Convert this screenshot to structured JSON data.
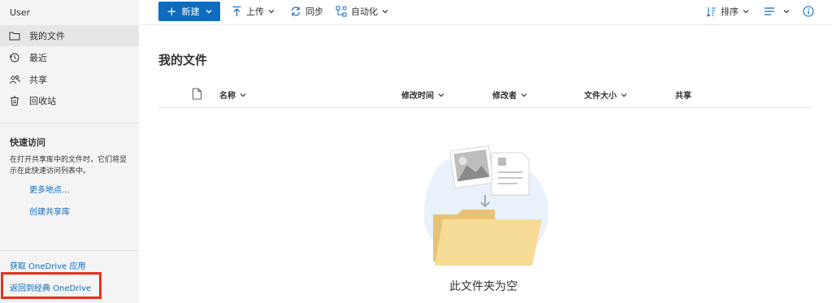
{
  "sidebar": {
    "user": "User",
    "nav": [
      {
        "label": "我的文件",
        "icon": "folder-icon",
        "active": true
      },
      {
        "label": "最近",
        "icon": "history-icon",
        "active": false
      },
      {
        "label": "共享",
        "icon": "people-icon",
        "active": false
      },
      {
        "label": "回收站",
        "icon": "recycle-bin-icon",
        "active": false
      }
    ],
    "quick_access": {
      "title": "快速访问",
      "description": "在打开共享库中的文件时，它们将显示在此快速访问列表中。",
      "more_places": "更多地点...",
      "create_library": "创建共享库"
    },
    "get_app": "获取 OneDrive 应用",
    "return_classic": "返回到经典 OneDrive"
  },
  "toolbar": {
    "new_label": "新建",
    "upload_label": "上传",
    "sync_label": "同步",
    "automate_label": "自动化",
    "sort_label": "排序"
  },
  "main": {
    "title": "我的文件",
    "columns": {
      "name": "名称",
      "modified": "修改时间",
      "modified_by": "修改者",
      "size": "文件大小",
      "sharing": "共享"
    },
    "empty_message": "此文件夹为空"
  },
  "colors": {
    "accent": "#0f6cbd",
    "sidebar_bg": "#f4f4f4",
    "active_bg": "#e6e6e6",
    "highlight": "#e8311a"
  }
}
